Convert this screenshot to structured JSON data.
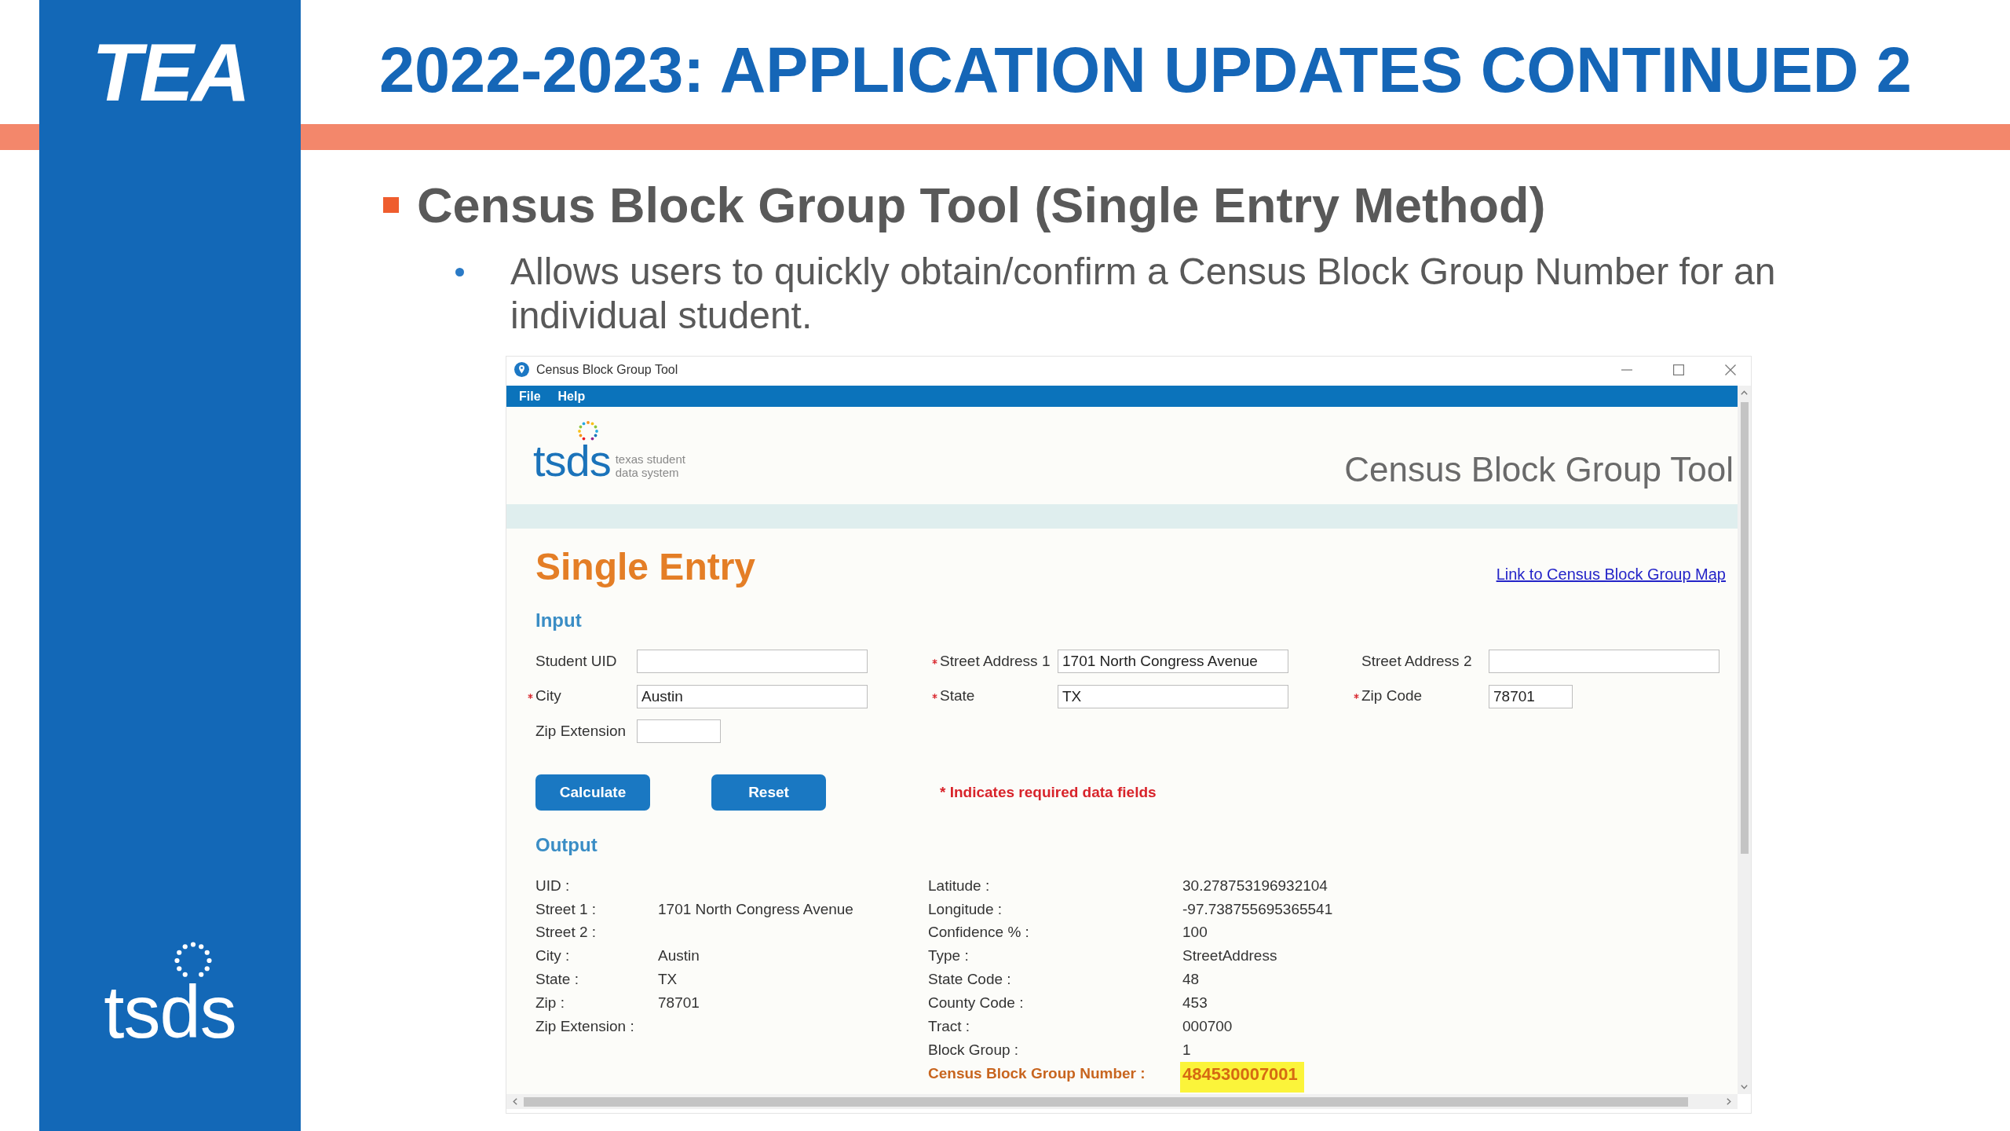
{
  "slide": {
    "logo": "TEA",
    "title": "2022-2023: APPLICATION UPDATES CONTINUED 2",
    "bullets": [
      {
        "text": "Census Block Group Tool (Single Entry Method)",
        "children": [
          {
            "text": "Allows users to quickly obtain/confirm a Census Block Group Number for an individual student."
          }
        ]
      }
    ],
    "footer_logo": "tsds"
  },
  "app_window": {
    "title": "Census Block Group Tool",
    "menu": [
      "File",
      "Help"
    ],
    "header": {
      "logo": "tsds",
      "logo_tagline": [
        "texas student",
        "data system"
      ],
      "title": "Census Block Group Tool"
    },
    "page_title": "Single Entry",
    "map_link": "Link to Census Block Group Map",
    "input": {
      "heading": "Input",
      "fields": [
        {
          "label": "Student UID",
          "required": false,
          "kind": "text"
        },
        {
          "label": "Street Address 1",
          "required": true,
          "kind": "text",
          "value": "1701 North Congress Avenue"
        },
        {
          "label": "Street Address 2",
          "required": false,
          "kind": "text"
        },
        {
          "label": "City",
          "required": true,
          "kind": "text",
          "value": "Austin"
        },
        {
          "label": "State",
          "required": true,
          "kind": "text",
          "value": "TX"
        },
        {
          "label": "Zip Code",
          "required": true,
          "kind": "code",
          "value": "78701"
        },
        {
          "label": "Zip Extension",
          "required": false,
          "kind": "code"
        }
      ],
      "buttons": [
        "Calculate",
        "Reset"
      ],
      "required_note": "* Indicates required data fields"
    },
    "output": {
      "heading": "Output",
      "columns": [
        {
          "rows": [
            {
              "label": "UID :",
              "highlighted": false
            },
            {
              "label": "Street 1 :",
              "value": "1701 North Congress Avenue",
              "highlighted": false
            },
            {
              "label": "Street 2 :",
              "highlighted": false
            },
            {
              "label": "City :",
              "value": "Austin",
              "highlighted": false
            },
            {
              "label": "State :",
              "value": "TX",
              "highlighted": false
            },
            {
              "label": "Zip :",
              "value": "78701",
              "highlighted": false
            },
            {
              "label": "Zip Extension :",
              "highlighted": false
            }
          ]
        },
        {
          "rows": [
            {
              "label": "Latitude :",
              "value": "30.278753196932104",
              "highlighted": false
            },
            {
              "label": "Longitude :",
              "value": "-97.738755695365541",
              "highlighted": false
            },
            {
              "label": "Confidence % :",
              "value": "100",
              "highlighted": false
            },
            {
              "label": "Type :",
              "value": "StreetAddress",
              "highlighted": false
            },
            {
              "label": "State Code :",
              "value": "48",
              "highlighted": false
            },
            {
              "label": "County Code :",
              "value": "453",
              "highlighted": false
            },
            {
              "label": "Tract :",
              "value": "000700",
              "highlighted": false
            },
            {
              "label": "Block Group :",
              "value": "1",
              "highlighted": false
            },
            {
              "label": "Census Block Group Number :",
              "value": "484530007001",
              "highlighted": true
            }
          ]
        }
      ]
    }
  }
}
